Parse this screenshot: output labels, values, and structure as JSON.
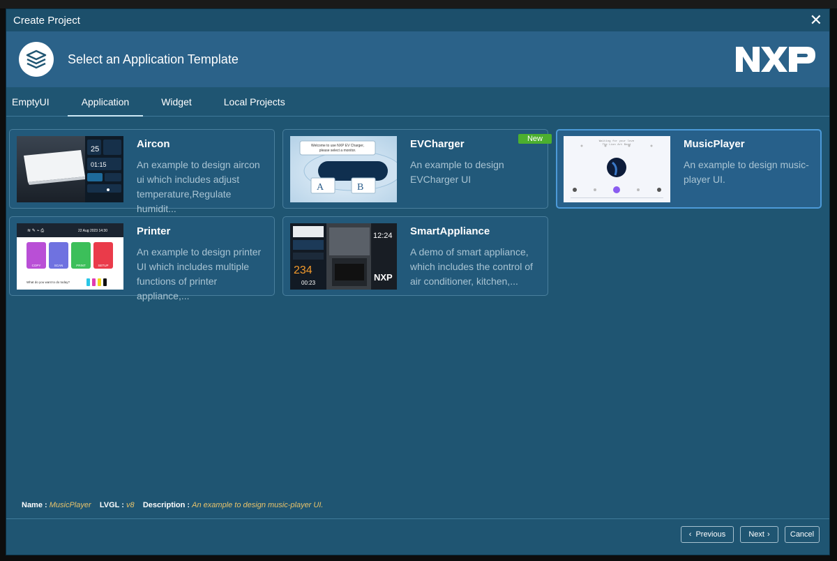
{
  "dialog": {
    "title": "Create Project"
  },
  "header": {
    "title": "Select an Application Template",
    "logo_text": "NXP"
  },
  "tabs": [
    {
      "label": "EmptyUI",
      "active": false
    },
    {
      "label": "Application",
      "active": true
    },
    {
      "label": "Widget",
      "active": false
    },
    {
      "label": "Local Projects",
      "active": false
    }
  ],
  "templates": [
    {
      "title": "Aircon",
      "desc": "An example to design aircon ui which includes adjust temperature,Regulate humidit...",
      "thumb": {
        "temp": "25",
        "time": "01:15"
      }
    },
    {
      "title": "EVCharger",
      "desc": "An example to design EVCharger UI",
      "badge": "New",
      "thumb": {
        "banner": "Welcome to use NXP EV Charger, please select a monitor.",
        "a": "A",
        "b": "B"
      }
    },
    {
      "title": "MusicPlayer",
      "desc": "An example to design music-player UI.",
      "selected": true
    },
    {
      "title": "Printer",
      "desc": "An example to design printer UI which includes multiple functions of printer appliance,...",
      "thumb": {
        "date": "22 Aug 2023 14:30",
        "buttons": [
          "COPY",
          "SCAN",
          "PRINT",
          "SETUP"
        ],
        "question": "What do you want to do today?"
      }
    },
    {
      "title": "SmartAppliance",
      "desc": "A demo of smart appliance, which includes the control of air conditioner, kitchen,...",
      "thumb": {
        "clock": "12:24",
        "num": "234",
        "timer": "00:23",
        "logo": "NXP"
      }
    }
  ],
  "info": {
    "name_label": "Name :",
    "name_value": "MusicPlayer",
    "lvgl_label": "LVGL :",
    "lvgl_value": "v8",
    "desc_label": "Description :",
    "desc_value": "An example to design music-player UI."
  },
  "buttons": {
    "previous": "Previous",
    "next": "Next",
    "cancel": "Cancel"
  },
  "colors": {
    "dialog_bg": "#1f5572",
    "header_bg": "#2b6289",
    "accent_green": "#4caf2f",
    "info_value": "#e8c36b"
  }
}
